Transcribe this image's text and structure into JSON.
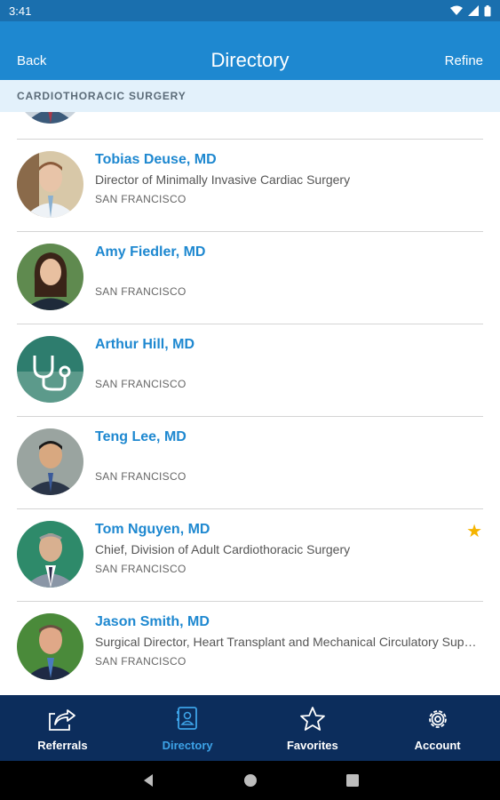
{
  "status_bar": {
    "time": "3:41"
  },
  "header": {
    "back_label": "Back",
    "title": "Directory",
    "refine_label": "Refine"
  },
  "section": {
    "label": "CARDIOTHORACIC SURGERY"
  },
  "doctors": [
    {
      "name": "Tobias Deuse, MD",
      "title": "Director of Minimally Invasive Cardiac Surgery",
      "location": "SAN FRANCISCO",
      "favorite": false
    },
    {
      "name": "Amy Fiedler, MD",
      "title": "",
      "location": "SAN FRANCISCO",
      "favorite": false
    },
    {
      "name": "Arthur Hill, MD",
      "title": "",
      "location": "SAN FRANCISCO",
      "favorite": false
    },
    {
      "name": "Teng Lee, MD",
      "title": "",
      "location": "SAN FRANCISCO",
      "favorite": false
    },
    {
      "name": "Tom Nguyen, MD",
      "title": "Chief, Division of Adult Cardiothoracic Surgery",
      "location": "SAN FRANCISCO",
      "favorite": true
    },
    {
      "name": "Jason Smith, MD",
      "title": "Surgical Director, Heart Transplant and Mechanical Circulatory Support",
      "location": "SAN FRANCISCO",
      "favorite": false
    }
  ],
  "tabs": [
    {
      "label": "Referrals",
      "icon": "share-icon",
      "active": false
    },
    {
      "label": "Directory",
      "icon": "contact-card-icon",
      "active": true
    },
    {
      "label": "Favorites",
      "icon": "star-icon",
      "active": false
    },
    {
      "label": "Account",
      "icon": "gear-icon",
      "active": false
    }
  ],
  "colors": {
    "primary": "#1e88d0",
    "tab_bar": "#0c2d5c",
    "active_tab": "#3da3e8",
    "favorite": "#f5b400"
  }
}
